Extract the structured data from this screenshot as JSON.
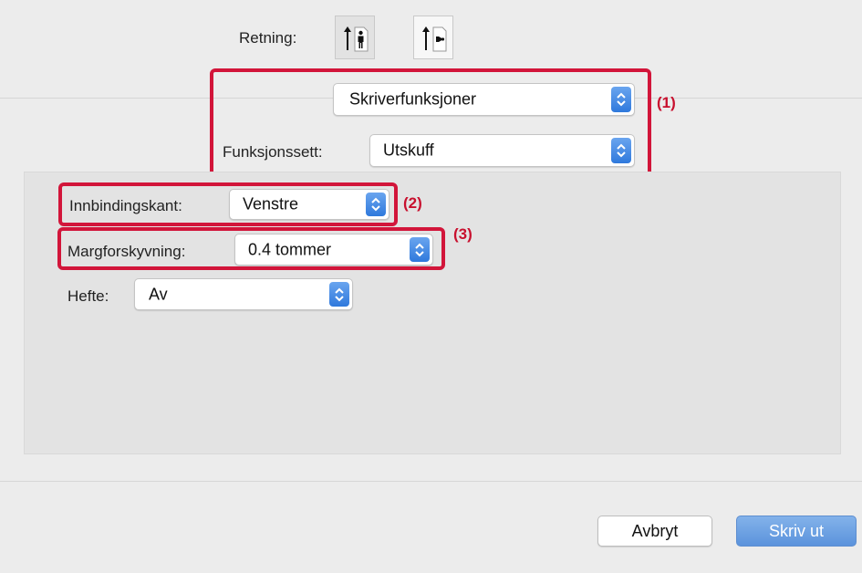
{
  "orientation": {
    "label": "Retning:",
    "options": [
      {
        "name": "portrait",
        "selected": true
      },
      {
        "name": "landscape",
        "selected": false
      }
    ]
  },
  "section_select": {
    "value": "Skriverfunksjoner"
  },
  "feature_set": {
    "label": "Funksjonssett:",
    "value": "Utskuff"
  },
  "binding_edge": {
    "label": "Innbindingskant:",
    "value": "Venstre"
  },
  "margin_shift": {
    "label": "Margforskyvning:",
    "value": "0.4 tommer"
  },
  "staple": {
    "label": "Hefte:",
    "value": "Av"
  },
  "callouts": {
    "one": "(1)",
    "two": "(2)",
    "three": "(3)"
  },
  "buttons": {
    "cancel": "Avbryt",
    "print": "Skriv ut"
  },
  "colors": {
    "accent": "#3b82e0",
    "highlight": "#d2153a"
  },
  "icons": {
    "stepper": "up-down-chevron-icon"
  }
}
